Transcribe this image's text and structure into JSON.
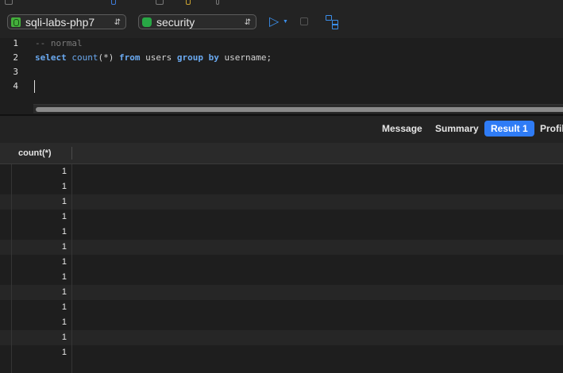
{
  "toolbar": {
    "connection": "sqli-labs-php7",
    "database": "security",
    "run_icon": "play-icon",
    "stop_icon": "stop-icon",
    "explain_icon": "explain-plan-icon"
  },
  "editor": {
    "lines": [
      {
        "num": "1"
      },
      {
        "num": "2"
      },
      {
        "num": "3"
      },
      {
        "num": "4"
      }
    ],
    "line1_comment": "-- normal",
    "line2": {
      "kw_select": "select",
      "fn_count": "count",
      "args": "(*)",
      "kw_from": "from",
      "table": "users",
      "kw_group": "group",
      "kw_by": "by",
      "column": "username;"
    }
  },
  "result_tabs": [
    "Message",
    "Summary",
    "Result 1",
    "Profile"
  ],
  "active_tab": "Result 1",
  "grid": {
    "columns": [
      "count(*)"
    ],
    "rows": [
      "1",
      "1",
      "1",
      "1",
      "1",
      "1",
      "1",
      "1",
      "1",
      "1",
      "1",
      "1",
      "1"
    ]
  },
  "colors": {
    "accent": "#2f7cf6",
    "keyword": "#6aa9f0",
    "comment": "#7a7a7a",
    "conn_icon": "#44b03c"
  }
}
